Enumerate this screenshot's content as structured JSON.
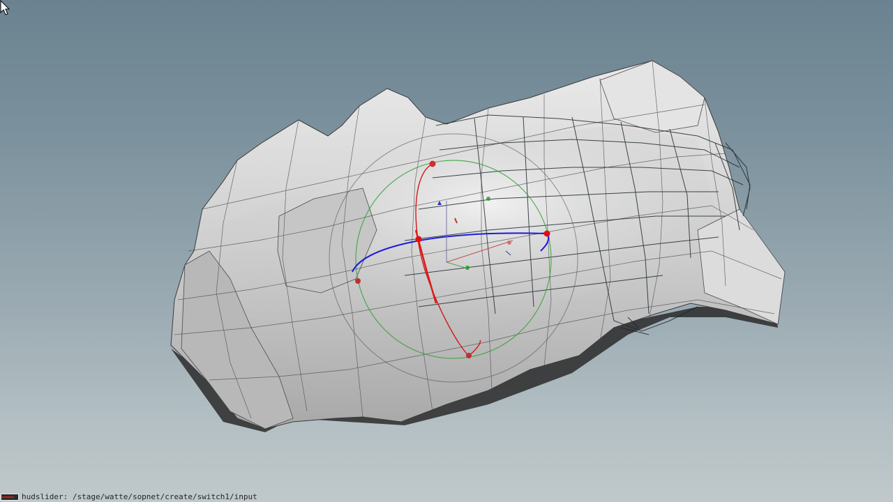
{
  "viewport": {
    "name": "scene-viewer",
    "background_top": "#6b8290",
    "background_bottom": "#c0c8ca",
    "mesh_color": "#d4d4d4",
    "wire_color": "#2a3438",
    "handle_colors": {
      "x_axis": "#e01818",
      "y_axis": "#30a030",
      "z_axis": "#1a1ae0"
    }
  },
  "status": {
    "text": "hudslider: /stage/watte/sopnet/create/switch1/input",
    "swatch_color": "#d01818"
  },
  "cursor": {
    "icon": "arrow-pointer-icon"
  }
}
